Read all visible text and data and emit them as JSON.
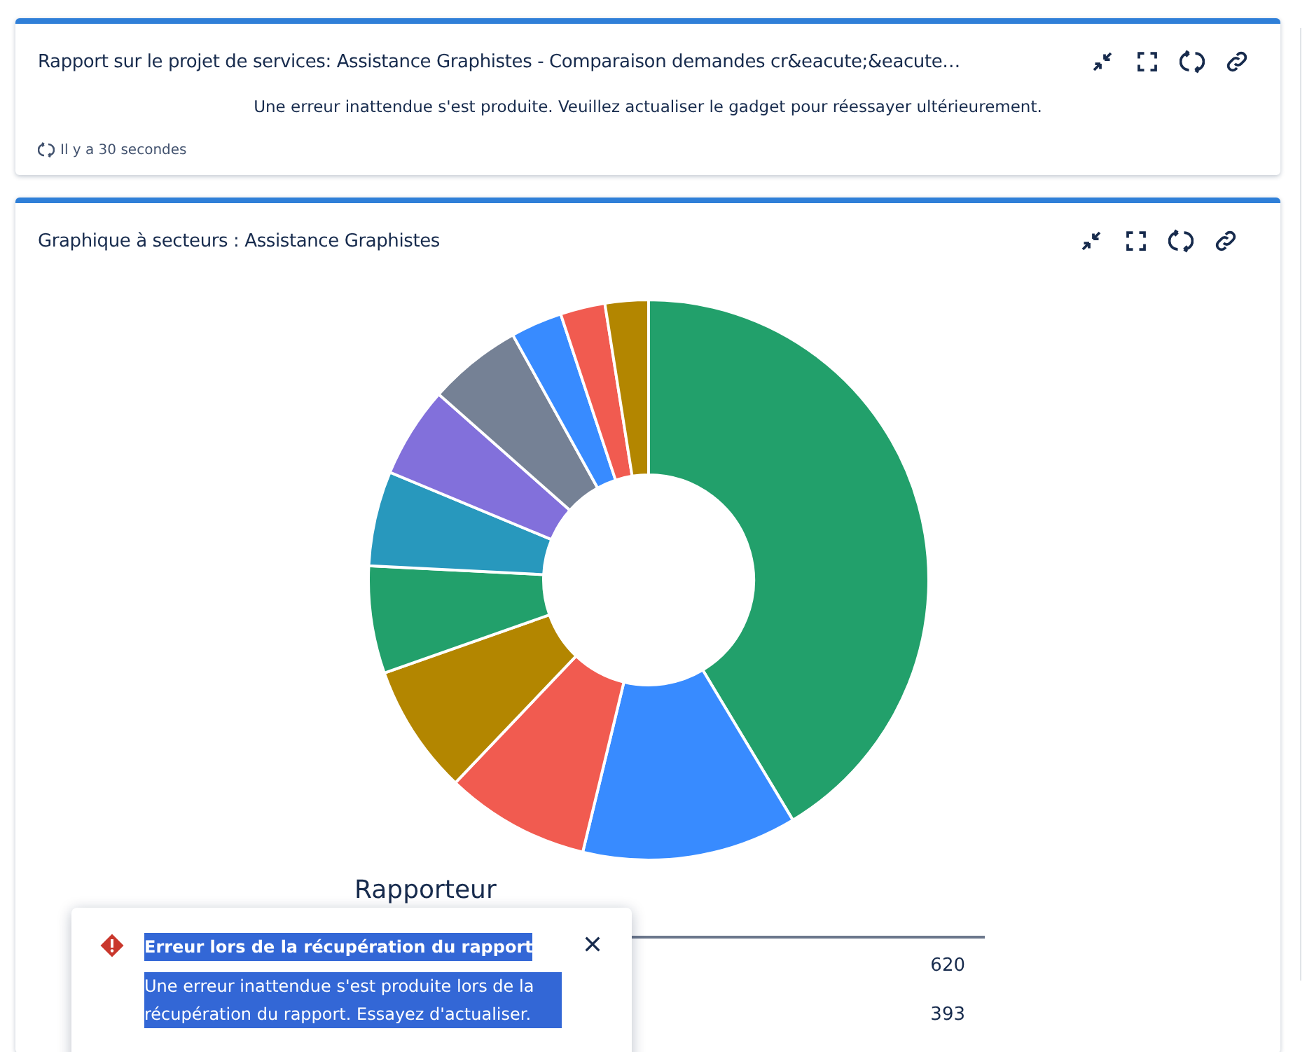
{
  "gadgets": [
    {
      "title": "Rapport sur le projet de services: Assistance Graphistes - Comparaison demandes cr&eacute;&eacute…",
      "error": "Une erreur inattendue s'est produite. Veuillez actualiser le gadget pour réessayer ultérieurement.",
      "refreshed": "Il y a 30 secondes"
    },
    {
      "title": "Graphique à secteurs : Assistance Graphistes",
      "table": {
        "heading": "Rapporteur",
        "rows": [
          {
            "value": "620"
          },
          {
            "value": "393"
          }
        ]
      }
    }
  ],
  "toast": {
    "title": "Erreur lors de la récupération du rapport",
    "message": "Une erreur inattendue s'est produite lors de la récupération du rapport. Essayez d'actualiser."
  }
}
